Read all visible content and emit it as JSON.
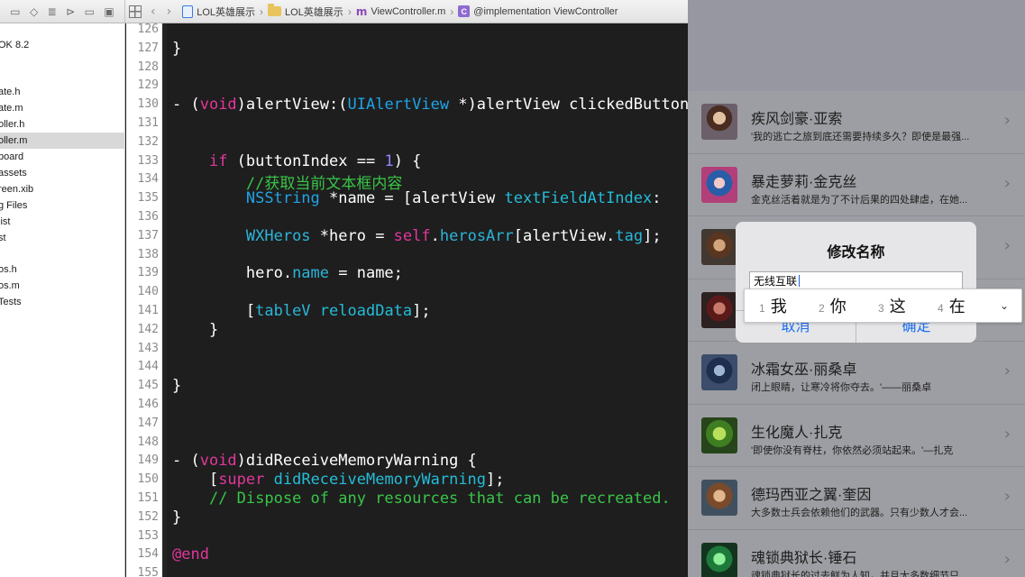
{
  "jumpbar": {
    "crumbs": [
      "LOL英雄展示",
      "LOL英雄展示",
      "ViewController.m",
      "@implementation ViewController"
    ]
  },
  "navigator": {
    "items": [
      "OK 8.2",
      "ate.h",
      "ate.m",
      "oller.h",
      "oller.m",
      "board",
      "assets",
      "reen.xib",
      "g Files",
      "list",
      "st",
      "os.h",
      "os.m",
      "Tests"
    ],
    "selected_index": 4
  },
  "editor": {
    "line_numbers": [
      "126",
      "127",
      "128",
      "129",
      "130",
      "131",
      "132",
      "133",
      "134",
      "135",
      "136",
      "137",
      "138",
      "139",
      "140",
      "141",
      "142",
      "143",
      "144",
      "145",
      "146",
      "147",
      "148",
      "149",
      "150",
      "151",
      "152",
      "153",
      "154",
      "155"
    ]
  },
  "app": {
    "heroes": [
      {
        "name": "疾风剑豪·亚索",
        "desc": "'我的逃亡之旅到底还需要持续多久？即使是最强..."
      },
      {
        "name": "暴走萝莉·金克丝",
        "desc": "金克丝活着就是为了不计后果的四处肆虐，在她..."
      },
      {
        "name": "",
        "desc": ""
      },
      {
        "name": "",
        "desc": ""
      },
      {
        "name": "冰霜女巫·丽桑卓",
        "desc": "闭上眼睛，让寒冷将你夺去。'——丽桑卓"
      },
      {
        "name": "生化魔人·扎克",
        "desc": "'即使你没有脊柱，你依然必须站起来。'—扎克"
      },
      {
        "name": "德玛西亚之翼·奎因",
        "desc": "大多数士兵会依赖他们的武器。只有少数人才会..."
      },
      {
        "name": "魂锁典狱长·锤石",
        "desc": "魂锁典狱长的过去鲜为人知，并且大多数细节只..."
      }
    ],
    "alert": {
      "title": "修改名称",
      "field_value": "无线互联",
      "cancel_label": "取消",
      "ok_label": "确定"
    },
    "candidates": [
      {
        "index": "1",
        "char": "我"
      },
      {
        "index": "2",
        "char": "你"
      },
      {
        "index": "3",
        "char": "这"
      },
      {
        "index": "4",
        "char": "在"
      }
    ]
  },
  "colors": {
    "editor_bg": "#1e1e1e",
    "keyword": "#e2379c",
    "class": "#20a3e6",
    "comment": "#39c548",
    "number": "#8f84ff",
    "ios_blue": "#1d6ff2"
  }
}
